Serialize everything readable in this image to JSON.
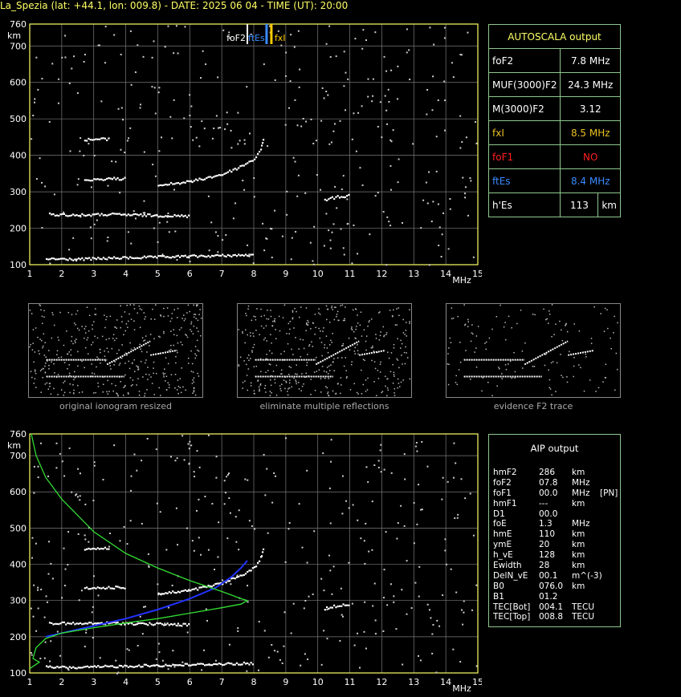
{
  "header": "La_Spezia (lat: +44.1, lon: 009.8) - DATE: 2025 06 04 - TIME (UT): 20:00",
  "colors": {
    "axis": "#ffff66",
    "grid": "#7a7a7a",
    "trace": "#ffffff",
    "foF2_marker": "#ffffff",
    "ftEs_marker": "#3a8cff",
    "fxI_marker": "#ffcc00",
    "profile_blue": "#2233ff",
    "profile_green": "#33dd33",
    "table_border": "#8fc88f",
    "red_value": "#ff2020",
    "blue_value": "#3a8cff",
    "yellow_value": "#e8c020"
  },
  "autoscala": {
    "title": "AUTOSCALA output",
    "rows": [
      {
        "label": "foF2",
        "value": "7.8 MHz",
        "color": "#ffffff"
      },
      {
        "label": "MUF(3000)F2",
        "value": "24.3 MHz",
        "color": "#ffffff"
      },
      {
        "label": "M(3000)F2",
        "value": "3.12",
        "color": "#ffffff"
      },
      {
        "label": "fxI",
        "value": "8.5 MHz",
        "color": "#e8c020"
      },
      {
        "label": "foF1",
        "value": "NO",
        "color": "#ff2020"
      },
      {
        "label": "ftEs",
        "value": "8.4 MHz",
        "color": "#3a8cff"
      },
      {
        "label": "h'Es",
        "value": "113",
        "unit": "km",
        "color": "#ffffff"
      }
    ]
  },
  "markers": {
    "foF2": {
      "label": "foF2",
      "freq": 7.8
    },
    "ftEs": {
      "label": "ftEs",
      "freq": 8.4
    },
    "fxI": {
      "label": "fxI",
      "freq": 8.5
    }
  },
  "thumb_captions": [
    "original ionogram resized",
    "eliminate multiple reflections",
    "evidence F2 trace"
  ],
  "aip": {
    "title": "AIP output",
    "rows": [
      [
        "hmF2",
        "286",
        "km",
        ""
      ],
      [
        "foF2",
        "07.8",
        "MHz",
        ""
      ],
      [
        "foF1",
        "00.0",
        "MHz",
        "[PN]"
      ],
      [
        "hmF1",
        "---",
        "km",
        ""
      ],
      [
        "D1",
        "00.0",
        "",
        ""
      ],
      [
        "foE",
        "1.3",
        "MHz",
        ""
      ],
      [
        "hmE",
        "110",
        "km",
        ""
      ],
      [
        "ymE",
        "20",
        "km",
        ""
      ],
      [
        "h_vE",
        "128",
        "km",
        ""
      ],
      [
        "Ewidth",
        "28",
        "km",
        ""
      ],
      [
        "DelN_vE",
        "00.1",
        "m^(-3)",
        ""
      ],
      [
        "B0",
        "076.0",
        "km",
        ""
      ],
      [
        "B1",
        "01.2",
        "",
        ""
      ],
      [
        "TEC[Bot]",
        "004.1",
        "TECU",
        ""
      ],
      [
        "TEC[Top]",
        "008.8",
        "TECU",
        ""
      ]
    ]
  },
  "chart_data": [
    {
      "type": "scatter",
      "title": "",
      "xlabel": "MHz",
      "ylabel": "km",
      "xlim": [
        1,
        15
      ],
      "ylim": [
        100,
        760
      ],
      "xticks": [
        1,
        2,
        3,
        4,
        5,
        6,
        7,
        8,
        9,
        10,
        11,
        12,
        13,
        14,
        15
      ],
      "yticks": [
        100,
        200,
        300,
        400,
        500,
        600,
        700,
        760
      ],
      "series": [
        {
          "values": [
            [
              1.5,
              118
            ],
            [
              2.5,
              117
            ],
            [
              3.5,
              120
            ],
            [
              4.5,
              122
            ],
            [
              5.5,
              124
            ],
            [
              6.5,
              126
            ],
            [
              7.5,
              128
            ],
            [
              8,
              128
            ]
          ]
        },
        {
          "values": [
            [
              1.6,
              240
            ],
            [
              2.5,
              238
            ],
            [
              3.5,
              240
            ],
            [
              4.5,
              238
            ],
            [
              5.5,
              236
            ],
            [
              6,
              235
            ]
          ]
        },
        {
          "values": [
            [
              2.7,
              335
            ],
            [
              3.5,
              338
            ],
            [
              4,
              338
            ]
          ]
        },
        {
          "values": [
            [
              2.7,
              445
            ],
            [
              3.5,
              447
            ]
          ]
        },
        {
          "values": [
            [
              5,
              320
            ],
            [
              6,
              330
            ],
            [
              6.5,
              340
            ],
            [
              7,
              350
            ],
            [
              7.5,
              368
            ],
            [
              8,
              392
            ],
            [
              8.2,
              420
            ],
            [
              8.3,
              450
            ]
          ]
        },
        {
          "values": [
            [
              10.2,
              280
            ],
            [
              10.6,
              288
            ],
            [
              11,
              292
            ]
          ]
        }
      ]
    },
    {
      "type": "line",
      "title": "",
      "xlabel": "MHz",
      "ylabel": "km",
      "xlim": [
        1,
        15
      ],
      "ylim": [
        100,
        760
      ],
      "series": [
        {
          "values": [
            [
              1.5,
              200
            ],
            [
              2,
              210
            ],
            [
              3,
              230
            ],
            [
              4,
              250
            ],
            [
              5,
              275
            ],
            [
              6,
              305
            ],
            [
              6.8,
              335
            ],
            [
              7.3,
              365
            ],
            [
              7.6,
              390
            ],
            [
              7.8,
              410
            ]
          ]
        },
        {
          "values": [
            [
              1.05,
              760
            ],
            [
              1.2,
              700
            ],
            [
              1.5,
              640
            ],
            [
              2,
              580
            ],
            [
              3,
              490
            ],
            [
              4,
              430
            ],
            [
              5,
              390
            ],
            [
              6,
              355
            ],
            [
              7,
              325
            ],
            [
              7.6,
              305
            ],
            [
              7.8,
              300
            ],
            [
              7.6,
              290
            ],
            [
              7,
              280
            ],
            [
              6,
              265
            ],
            [
              5,
              250
            ],
            [
              4,
              238
            ],
            [
              3,
              225
            ],
            [
              2,
              210
            ],
            [
              1.5,
              195
            ],
            [
              1.2,
              170
            ],
            [
              1.1,
              140
            ],
            [
              1.3,
              130
            ],
            [
              1.1,
              118
            ],
            [
              1,
              112
            ]
          ]
        }
      ]
    }
  ]
}
